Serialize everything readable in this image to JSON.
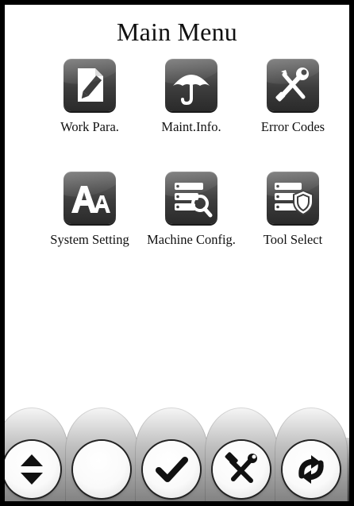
{
  "screen": {
    "title": "Main Menu"
  },
  "menu": {
    "items": [
      {
        "label": "Work Para.",
        "icon": "document-pencil-icon"
      },
      {
        "label": "Maint.Info.",
        "icon": "umbrella-icon"
      },
      {
        "label": "Error Codes",
        "icon": "wrench-screwdriver-icon"
      },
      {
        "label": "System Setting",
        "icon": "font-aa-icon"
      },
      {
        "label": "Machine Config.",
        "icon": "database-search-icon"
      },
      {
        "label": "Tool Select",
        "icon": "database-shield-icon"
      }
    ]
  },
  "toolbar": {
    "buttons": [
      {
        "icon": "up-down-arrows-icon"
      },
      {
        "icon": ""
      },
      {
        "icon": "checkmark-icon"
      },
      {
        "icon": "hammer-wrench-icon"
      },
      {
        "icon": "sync-arrows-icon"
      }
    ]
  },
  "colors": {
    "tile_dark": "#3d3d3d",
    "frame": "#000000",
    "background": "#ffffff"
  }
}
